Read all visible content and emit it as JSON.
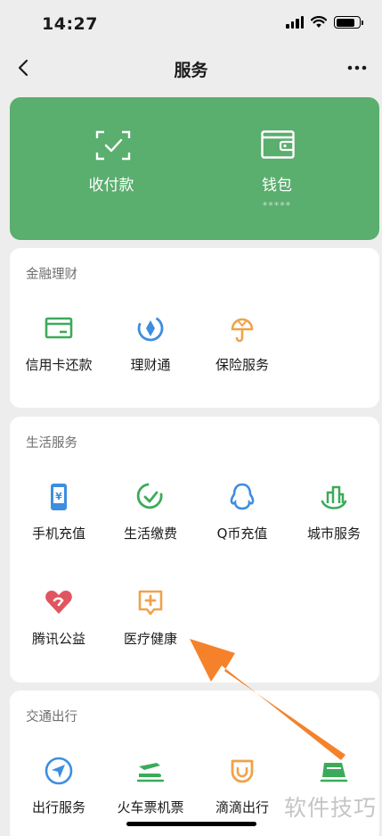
{
  "status": {
    "time": "14:27"
  },
  "nav": {
    "title": "服务"
  },
  "hero": {
    "pay": {
      "label": "收付款",
      "icon": "scan-check-icon"
    },
    "wallet": {
      "label": "钱包",
      "balance_masked": "*****",
      "icon": "wallet-icon"
    }
  },
  "finance": {
    "title": "金融理财",
    "items": [
      {
        "label": "信用卡还款",
        "icon": "credit-card-icon",
        "color": "#3bab59"
      },
      {
        "label": "理财通",
        "icon": "wealth-icon",
        "color": "#3d8ee0"
      },
      {
        "label": "保险服务",
        "icon": "insurance-icon",
        "color": "#f0a24b"
      }
    ]
  },
  "life": {
    "title": "生活服务",
    "items": [
      {
        "label": "手机充值",
        "icon": "phone-recharge-icon",
        "color": "#3d8ee0"
      },
      {
        "label": "生活缴费",
        "icon": "bill-pay-icon",
        "color": "#3bab59"
      },
      {
        "label": "Q币充值",
        "icon": "qq-icon",
        "color": "#3d8ee0"
      },
      {
        "label": "城市服务",
        "icon": "city-icon",
        "color": "#3bab59"
      },
      {
        "label": "腾讯公益",
        "icon": "charity-icon",
        "color": "#e0555f"
      },
      {
        "label": "医疗健康",
        "icon": "medical-icon",
        "color": "#f0a24b"
      }
    ]
  },
  "travel": {
    "title": "交通出行",
    "items": [
      {
        "label": "出行服务",
        "icon": "navigation-icon",
        "color": "#3d8ee0"
      },
      {
        "label": "火车票机票",
        "icon": "train-icon",
        "color": "#3bab59"
      },
      {
        "label": "滴滴出行",
        "icon": "didi-icon",
        "color": "#f0a24b"
      },
      {
        "label": "",
        "icon": "hotel-icon",
        "color": "#3bab59"
      }
    ]
  },
  "watermark": "软件技巧",
  "colors": {
    "hero_bg": "#5aae6e",
    "page_bg": "#ededed",
    "annotation_arrow": "#f5822a"
  }
}
